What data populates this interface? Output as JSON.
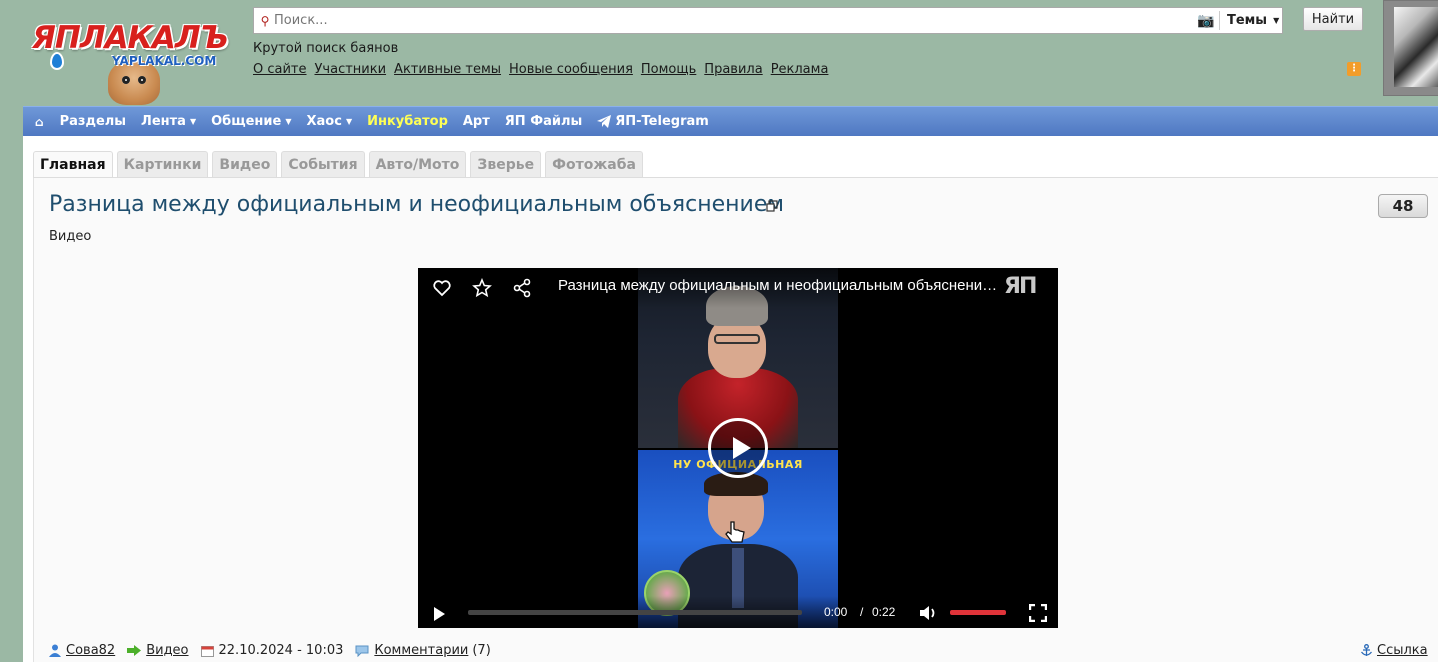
{
  "header": {
    "logo_text": "ЯПЛАКАЛЪ",
    "logo_domain": "YAPLAKAL.COM",
    "search_placeholder": "Поиск...",
    "search_scope": "Темы",
    "find_button": "Найти",
    "tagline": "Крутой поиск баянов",
    "links": [
      "О сайте",
      "Участники",
      "Активные темы",
      "Новые сообщения",
      "Помощь",
      "Правила",
      "Реклама"
    ]
  },
  "nav": {
    "items": [
      {
        "label": "Разделы",
        "dropdown": false
      },
      {
        "label": "Лента",
        "dropdown": true
      },
      {
        "label": "Общение",
        "dropdown": true
      },
      {
        "label": "Хаос",
        "dropdown": true
      },
      {
        "label": "Инкубатор",
        "dropdown": false,
        "highlight": true
      },
      {
        "label": "Арт",
        "dropdown": false
      },
      {
        "label": "ЯП Файлы",
        "dropdown": false
      },
      {
        "label": "ЯП-Telegram",
        "dropdown": false,
        "icon": "telegram-icon"
      }
    ]
  },
  "tabs": [
    "Главная",
    "Картинки",
    "Видео",
    "События",
    "Авто/Мото",
    "Зверье",
    "Фотожаба"
  ],
  "active_tab": 0,
  "post": {
    "title": "Разница между официальным и неофициальным объяснением",
    "comment_count": "48",
    "category": "Видео",
    "author": "Сова82",
    "section": "Видео",
    "date": "22.10.2024 - 10:03",
    "comments_label": "Комментарии",
    "comments_count": "(7)",
    "link_label": "Ссылка"
  },
  "player": {
    "title": "Разница между официальным и неофициальным объяснением",
    "logo": "ЯП",
    "caption": "НУ ОФИЦИАЛЬНАЯ",
    "time_current": "0:00",
    "time_separator": "/",
    "time_duration": "0:22",
    "progress": 0,
    "volume": 1.0
  },
  "colors": {
    "background": "#9bb8a4",
    "nav": "#5a83c9",
    "nav_highlight": "#ffff55",
    "title": "#1f4e6e",
    "volume": "#e0343a"
  }
}
